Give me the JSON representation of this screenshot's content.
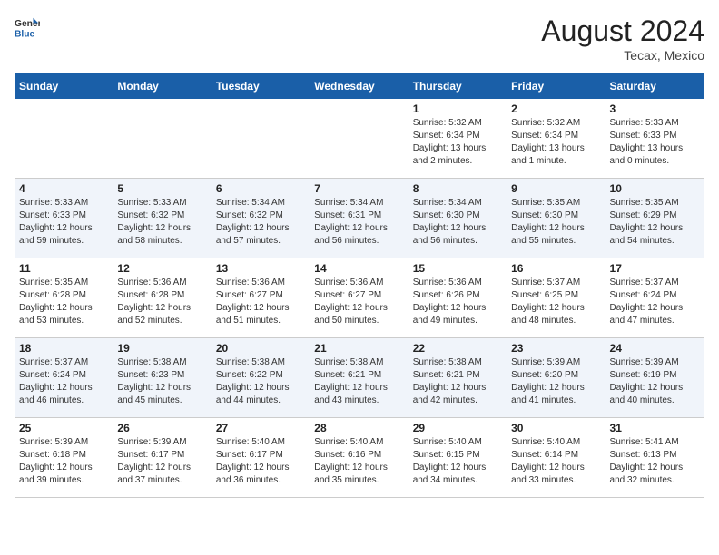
{
  "logo": {
    "general": "General",
    "blue": "Blue"
  },
  "header": {
    "month_year": "August 2024",
    "location": "Tecax, Mexico"
  },
  "days_of_week": [
    "Sunday",
    "Monday",
    "Tuesday",
    "Wednesday",
    "Thursday",
    "Friday",
    "Saturday"
  ],
  "weeks": [
    [
      {
        "day": "",
        "info": ""
      },
      {
        "day": "",
        "info": ""
      },
      {
        "day": "",
        "info": ""
      },
      {
        "day": "",
        "info": ""
      },
      {
        "day": "1",
        "info": "Sunrise: 5:32 AM\nSunset: 6:34 PM\nDaylight: 13 hours\nand 2 minutes."
      },
      {
        "day": "2",
        "info": "Sunrise: 5:32 AM\nSunset: 6:34 PM\nDaylight: 13 hours\nand 1 minute."
      },
      {
        "day": "3",
        "info": "Sunrise: 5:33 AM\nSunset: 6:33 PM\nDaylight: 13 hours\nand 0 minutes."
      }
    ],
    [
      {
        "day": "4",
        "info": "Sunrise: 5:33 AM\nSunset: 6:33 PM\nDaylight: 12 hours\nand 59 minutes."
      },
      {
        "day": "5",
        "info": "Sunrise: 5:33 AM\nSunset: 6:32 PM\nDaylight: 12 hours\nand 58 minutes."
      },
      {
        "day": "6",
        "info": "Sunrise: 5:34 AM\nSunset: 6:32 PM\nDaylight: 12 hours\nand 57 minutes."
      },
      {
        "day": "7",
        "info": "Sunrise: 5:34 AM\nSunset: 6:31 PM\nDaylight: 12 hours\nand 56 minutes."
      },
      {
        "day": "8",
        "info": "Sunrise: 5:34 AM\nSunset: 6:30 PM\nDaylight: 12 hours\nand 56 minutes."
      },
      {
        "day": "9",
        "info": "Sunrise: 5:35 AM\nSunset: 6:30 PM\nDaylight: 12 hours\nand 55 minutes."
      },
      {
        "day": "10",
        "info": "Sunrise: 5:35 AM\nSunset: 6:29 PM\nDaylight: 12 hours\nand 54 minutes."
      }
    ],
    [
      {
        "day": "11",
        "info": "Sunrise: 5:35 AM\nSunset: 6:28 PM\nDaylight: 12 hours\nand 53 minutes."
      },
      {
        "day": "12",
        "info": "Sunrise: 5:36 AM\nSunset: 6:28 PM\nDaylight: 12 hours\nand 52 minutes."
      },
      {
        "day": "13",
        "info": "Sunrise: 5:36 AM\nSunset: 6:27 PM\nDaylight: 12 hours\nand 51 minutes."
      },
      {
        "day": "14",
        "info": "Sunrise: 5:36 AM\nSunset: 6:27 PM\nDaylight: 12 hours\nand 50 minutes."
      },
      {
        "day": "15",
        "info": "Sunrise: 5:36 AM\nSunset: 6:26 PM\nDaylight: 12 hours\nand 49 minutes."
      },
      {
        "day": "16",
        "info": "Sunrise: 5:37 AM\nSunset: 6:25 PM\nDaylight: 12 hours\nand 48 minutes."
      },
      {
        "day": "17",
        "info": "Sunrise: 5:37 AM\nSunset: 6:24 PM\nDaylight: 12 hours\nand 47 minutes."
      }
    ],
    [
      {
        "day": "18",
        "info": "Sunrise: 5:37 AM\nSunset: 6:24 PM\nDaylight: 12 hours\nand 46 minutes."
      },
      {
        "day": "19",
        "info": "Sunrise: 5:38 AM\nSunset: 6:23 PM\nDaylight: 12 hours\nand 45 minutes."
      },
      {
        "day": "20",
        "info": "Sunrise: 5:38 AM\nSunset: 6:22 PM\nDaylight: 12 hours\nand 44 minutes."
      },
      {
        "day": "21",
        "info": "Sunrise: 5:38 AM\nSunset: 6:21 PM\nDaylight: 12 hours\nand 43 minutes."
      },
      {
        "day": "22",
        "info": "Sunrise: 5:38 AM\nSunset: 6:21 PM\nDaylight: 12 hours\nand 42 minutes."
      },
      {
        "day": "23",
        "info": "Sunrise: 5:39 AM\nSunset: 6:20 PM\nDaylight: 12 hours\nand 41 minutes."
      },
      {
        "day": "24",
        "info": "Sunrise: 5:39 AM\nSunset: 6:19 PM\nDaylight: 12 hours\nand 40 minutes."
      }
    ],
    [
      {
        "day": "25",
        "info": "Sunrise: 5:39 AM\nSunset: 6:18 PM\nDaylight: 12 hours\nand 39 minutes."
      },
      {
        "day": "26",
        "info": "Sunrise: 5:39 AM\nSunset: 6:17 PM\nDaylight: 12 hours\nand 37 minutes."
      },
      {
        "day": "27",
        "info": "Sunrise: 5:40 AM\nSunset: 6:17 PM\nDaylight: 12 hours\nand 36 minutes."
      },
      {
        "day": "28",
        "info": "Sunrise: 5:40 AM\nSunset: 6:16 PM\nDaylight: 12 hours\nand 35 minutes."
      },
      {
        "day": "29",
        "info": "Sunrise: 5:40 AM\nSunset: 6:15 PM\nDaylight: 12 hours\nand 34 minutes."
      },
      {
        "day": "30",
        "info": "Sunrise: 5:40 AM\nSunset: 6:14 PM\nDaylight: 12 hours\nand 33 minutes."
      },
      {
        "day": "31",
        "info": "Sunrise: 5:41 AM\nSunset: 6:13 PM\nDaylight: 12 hours\nand 32 minutes."
      }
    ]
  ]
}
